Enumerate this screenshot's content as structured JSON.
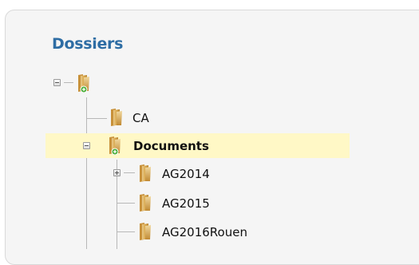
{
  "panel": {
    "title": "Dossiers"
  },
  "tree": {
    "root": {
      "label": "",
      "expanded": true,
      "icon": "folder-open-icon"
    },
    "nodes": [
      {
        "label": "CA",
        "expanded": false,
        "selected": false,
        "icon": "folder-icon"
      },
      {
        "label": "Documents",
        "expanded": true,
        "selected": true,
        "icon": "folder-open-icon",
        "children": [
          {
            "label": "AG2014",
            "has_children": true,
            "expanded": false,
            "icon": "folder-icon"
          },
          {
            "label": "AG2015",
            "has_children": false,
            "icon": "folder-icon"
          },
          {
            "label": "AG2016Rouen",
            "has_children": false,
            "icon": "folder-icon"
          }
        ]
      }
    ]
  },
  "colors": {
    "title": "#2e6da4",
    "selected_row": "#fff8c6",
    "panel_bg": "#f5f5f5"
  }
}
